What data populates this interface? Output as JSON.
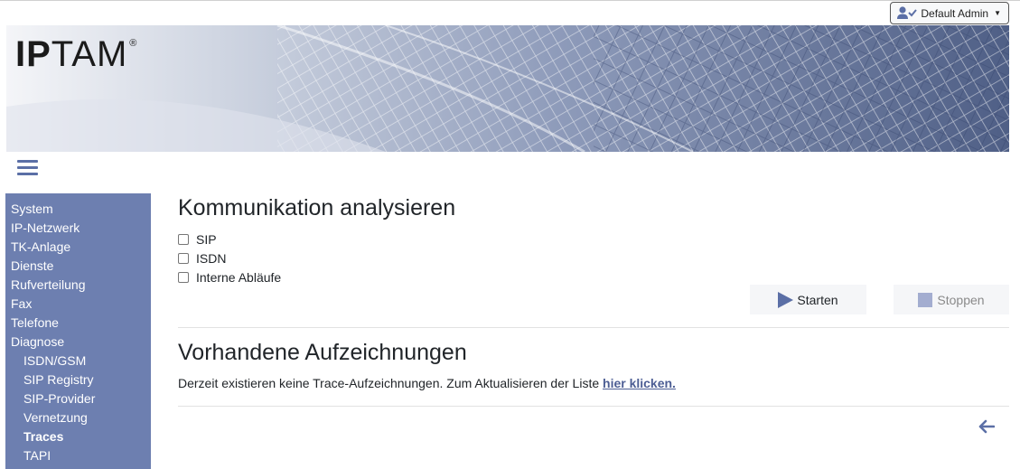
{
  "header": {
    "user_label": "Default Admin",
    "user_icon": "user-check-icon",
    "caret_icon": "caret-down-icon"
  },
  "banner": {
    "logo_strong": "IP",
    "logo_light": "TAM",
    "logo_mark": "®"
  },
  "nav": {
    "menu_icon": "hamburger-icon",
    "items": [
      {
        "label": "System"
      },
      {
        "label": "IP-Netzwerk"
      },
      {
        "label": "TK-Anlage"
      },
      {
        "label": "Dienste"
      },
      {
        "label": "Rufverteilung"
      },
      {
        "label": "Fax"
      },
      {
        "label": "Telefone"
      },
      {
        "label": "Diagnose"
      },
      {
        "label": "ISDN/GSM"
      },
      {
        "label": "SIP Registry"
      },
      {
        "label": "SIP-Provider"
      },
      {
        "label": "Vernetzung"
      },
      {
        "label": "Traces"
      },
      {
        "label": "TAPI"
      }
    ]
  },
  "main": {
    "title": "Kommunikation analysieren",
    "options": [
      {
        "label": "SIP",
        "checked": false
      },
      {
        "label": "ISDN",
        "checked": false
      },
      {
        "label": "Interne Abläufe",
        "checked": false
      }
    ],
    "start_label": "Starten",
    "stop_label": "Stoppen",
    "recordings_title": "Vorhandene Aufzeichnungen",
    "recordings_text": "Derzeit existieren keine Trace-Aufzeichnungen. Zum Aktualisieren der Liste ",
    "refresh_link": "hier klicken.",
    "back_icon": "arrow-left-icon"
  },
  "colors": {
    "accent": "#5b6fa6",
    "sidebar_bg": "#6d7fb0",
    "link": "#4d5e94"
  }
}
